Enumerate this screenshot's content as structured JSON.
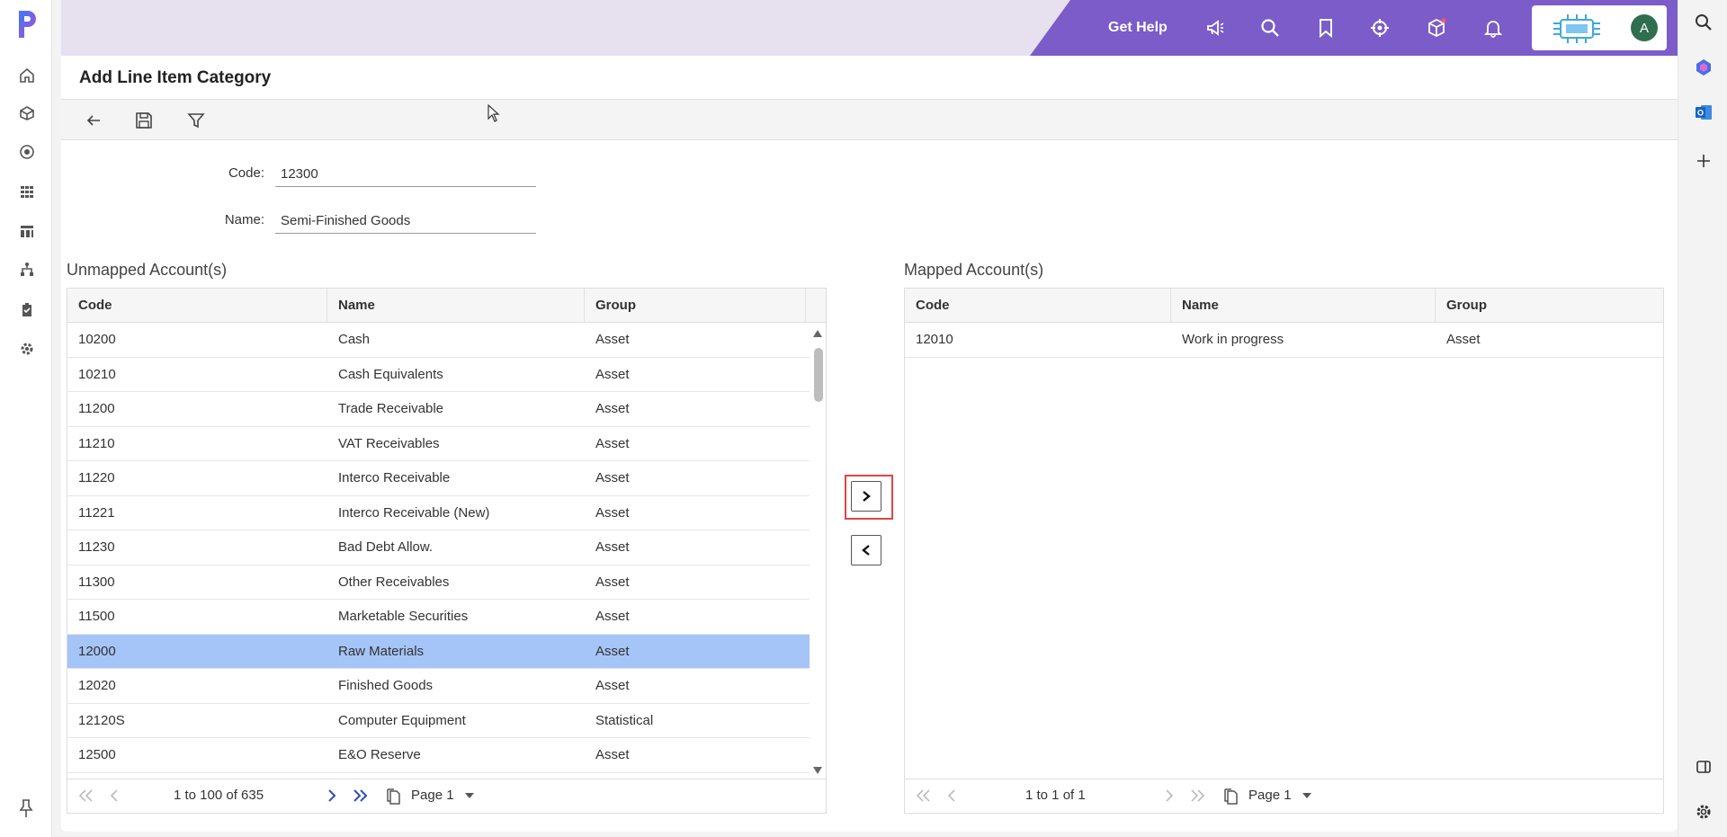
{
  "app": {
    "logo": "P"
  },
  "leftnav": {
    "icons": [
      "home-icon",
      "cube-icon",
      "target-icon",
      "grid-icon",
      "report-icon",
      "hierarchy-icon",
      "clipboard-icon",
      "gear-icon"
    ]
  },
  "topbar": {
    "get_help": "Get Help",
    "avatar_initial": "A"
  },
  "page": {
    "title": "Add Line Item Category"
  },
  "form": {
    "code_label": "Code:",
    "code_value": "12300",
    "name_label": "Name:",
    "name_value": "Semi-Finished Goods"
  },
  "unmapped": {
    "title": "Unmapped Account(s)",
    "columns": [
      "Code",
      "Name",
      "Group"
    ],
    "rows": [
      {
        "code": "10200",
        "name": "Cash",
        "group": "Asset"
      },
      {
        "code": "10210",
        "name": "Cash Equivalents",
        "group": "Asset"
      },
      {
        "code": "11200",
        "name": "Trade Receivable",
        "group": "Asset"
      },
      {
        "code": "11210",
        "name": "VAT Receivables",
        "group": "Asset"
      },
      {
        "code": "11220",
        "name": "Interco Receivable",
        "group": "Asset"
      },
      {
        "code": "11221",
        "name": "Interco Receivable (New)",
        "group": "Asset"
      },
      {
        "code": "11230",
        "name": "Bad Debt Allow.",
        "group": "Asset"
      },
      {
        "code": "11300",
        "name": "Other Receivables",
        "group": "Asset"
      },
      {
        "code": "11500",
        "name": "Marketable Securities",
        "group": "Asset"
      },
      {
        "code": "12000",
        "name": "Raw Materials",
        "group": "Asset",
        "selected": true
      },
      {
        "code": "12020",
        "name": "Finished Goods",
        "group": "Asset"
      },
      {
        "code": "12120S",
        "name": "Computer Equipment",
        "group": "Statistical"
      },
      {
        "code": "12500",
        "name": "E&O Reserve",
        "group": "Asset"
      }
    ],
    "footer": {
      "range": "1 to 100 of 635",
      "page": "Page 1"
    }
  },
  "mapped": {
    "title": "Mapped Account(s)",
    "columns": [
      "Code",
      "Name",
      "Group"
    ],
    "rows": [
      {
        "code": "12010",
        "name": "Work in progress",
        "group": "Asset"
      }
    ],
    "footer": {
      "range": "1 to 1 of 1",
      "page": "Page 1"
    }
  },
  "colors": {
    "accent": "#7b5cc8",
    "selected_row": "#a5c4f7",
    "highlight": "#e04444"
  }
}
